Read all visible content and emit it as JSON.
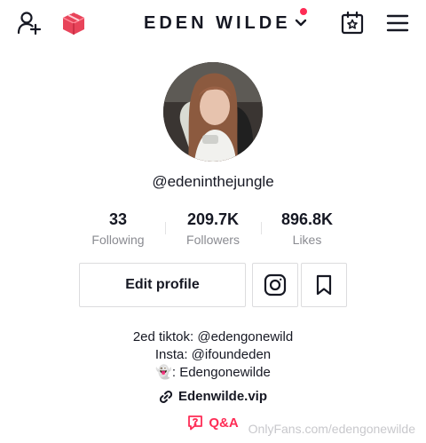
{
  "header": {
    "account_name": "EDEN WILDE",
    "icons": {
      "add_friend": "person-add-icon",
      "gift": "gift-box-icon",
      "dropdown": "chevron-down-icon",
      "calendar": "calendar-star-icon",
      "menu": "hamburger-menu-icon"
    },
    "notification_dot_color": "#fe2c55"
  },
  "profile": {
    "username": "@edeninthejungle",
    "stats": [
      {
        "value": "33",
        "label": "Following"
      },
      {
        "value": "209.7K",
        "label": "Followers"
      },
      {
        "value": "896.8K",
        "label": "Likes"
      }
    ]
  },
  "actions": {
    "edit_profile_label": "Edit profile",
    "instagram_icon": "instagram-icon",
    "bookmark_icon": "bookmark-icon"
  },
  "bio": {
    "line1": "2ed tiktok: @edengonewild",
    "line2": "Insta: @ifoundeden",
    "line3": "👻: Edengonewilde"
  },
  "link": {
    "text": "Edenwilde.vip",
    "icon": "link-icon"
  },
  "qa": {
    "text": "Q&A",
    "icon": "question-bubble-icon",
    "color": "#fe2c55"
  },
  "watermark": "OnlyFans.com/edengonewilde",
  "colors": {
    "accent": "#fe2c55",
    "text_primary": "#161823",
    "text_secondary": "#8a8b91",
    "border": "#dcdcde"
  }
}
